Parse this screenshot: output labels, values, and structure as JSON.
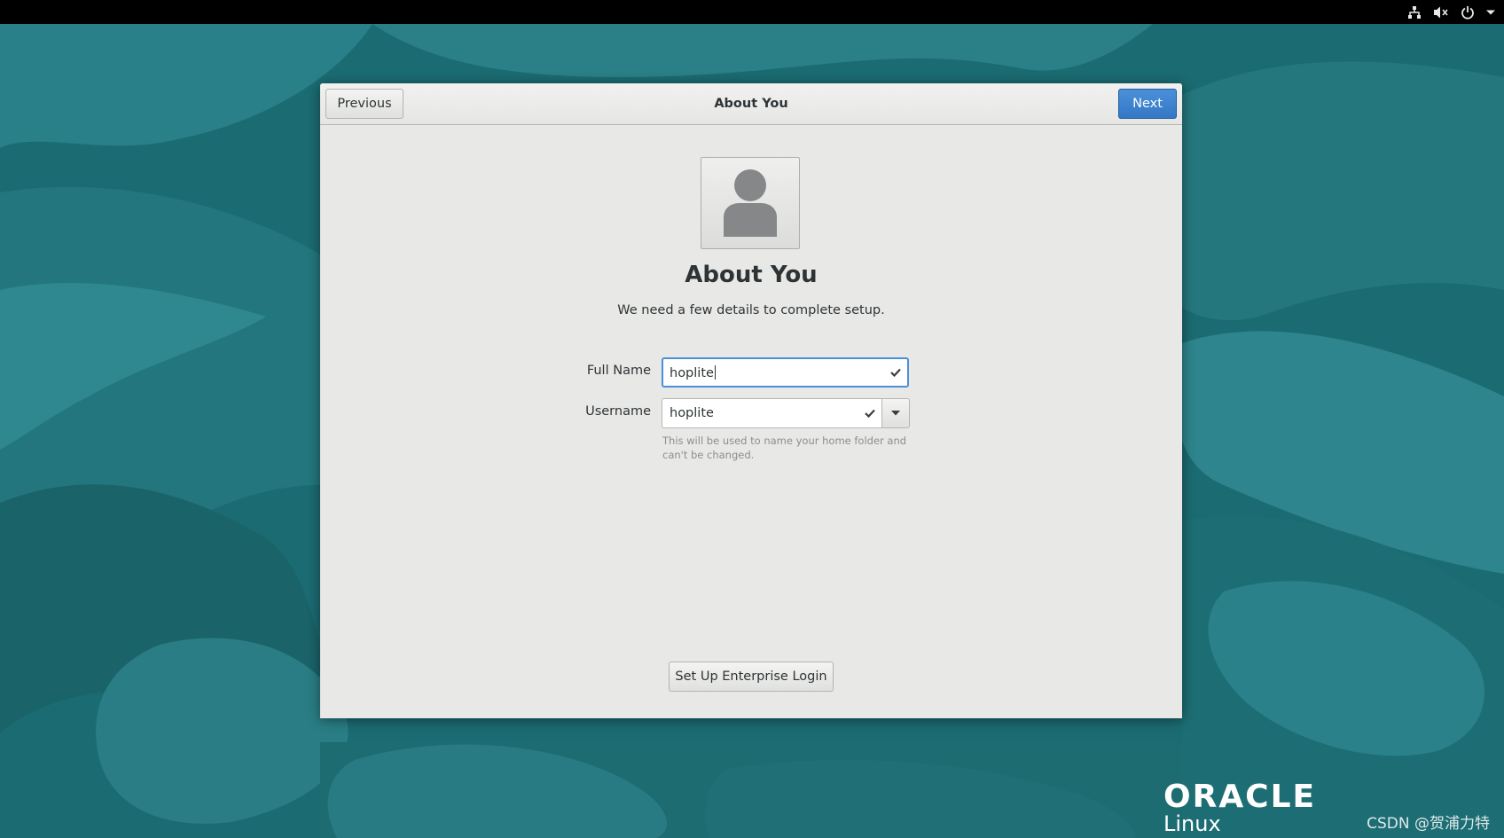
{
  "topbar": {
    "icons": [
      "network-wired-icon",
      "volume-muted-icon",
      "power-icon",
      "menu-arrow-icon"
    ]
  },
  "dialog": {
    "header_title": "About You",
    "previous_label": "Previous",
    "next_label": "Next",
    "heading": "About You",
    "subtitle": "We need a few details to complete setup.",
    "full_name": {
      "label": "Full Name",
      "value": "hoplite",
      "valid": true
    },
    "username": {
      "label": "Username",
      "value": "hoplite",
      "valid": true,
      "hint": "This will be used to name your home folder and can't be changed."
    },
    "enterprise_login_label": "Set Up Enterprise Login"
  },
  "branding": {
    "oracle": "ORACLE",
    "linux": "Linux"
  },
  "watermark": "CSDN @贺浦力特",
  "colors": {
    "accent": "#4a90d9",
    "next_button": "#3478c6",
    "wallpaper_base": "#1c6f75",
    "dialog_bg": "#e8e8e7",
    "topbar": "#000000"
  }
}
